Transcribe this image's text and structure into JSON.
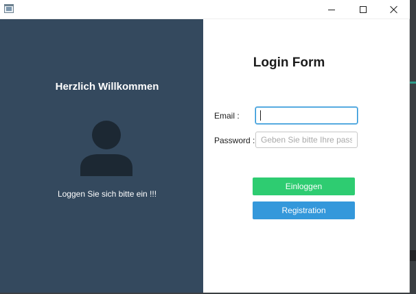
{
  "window": {
    "icon": "app-window-icon",
    "controls": [
      "minimize-icon",
      "maximize-icon",
      "close-icon"
    ]
  },
  "left_panel": {
    "welcome": "Herzlich Willkommen",
    "avatar_icon": "user-icon",
    "hint": "Loggen Sie sich bitte ein !!!",
    "color": "#34495e"
  },
  "form": {
    "title": "Login Form",
    "email": {
      "label": "Email :",
      "value": ""
    },
    "password": {
      "label": "Password :",
      "placeholder": "Geben Sie bitte Ihre passwort"
    },
    "login_button": {
      "label": "Einloggen",
      "color": "#2ecc71"
    },
    "register_button": {
      "label": "Registration",
      "color": "#3498db"
    }
  }
}
